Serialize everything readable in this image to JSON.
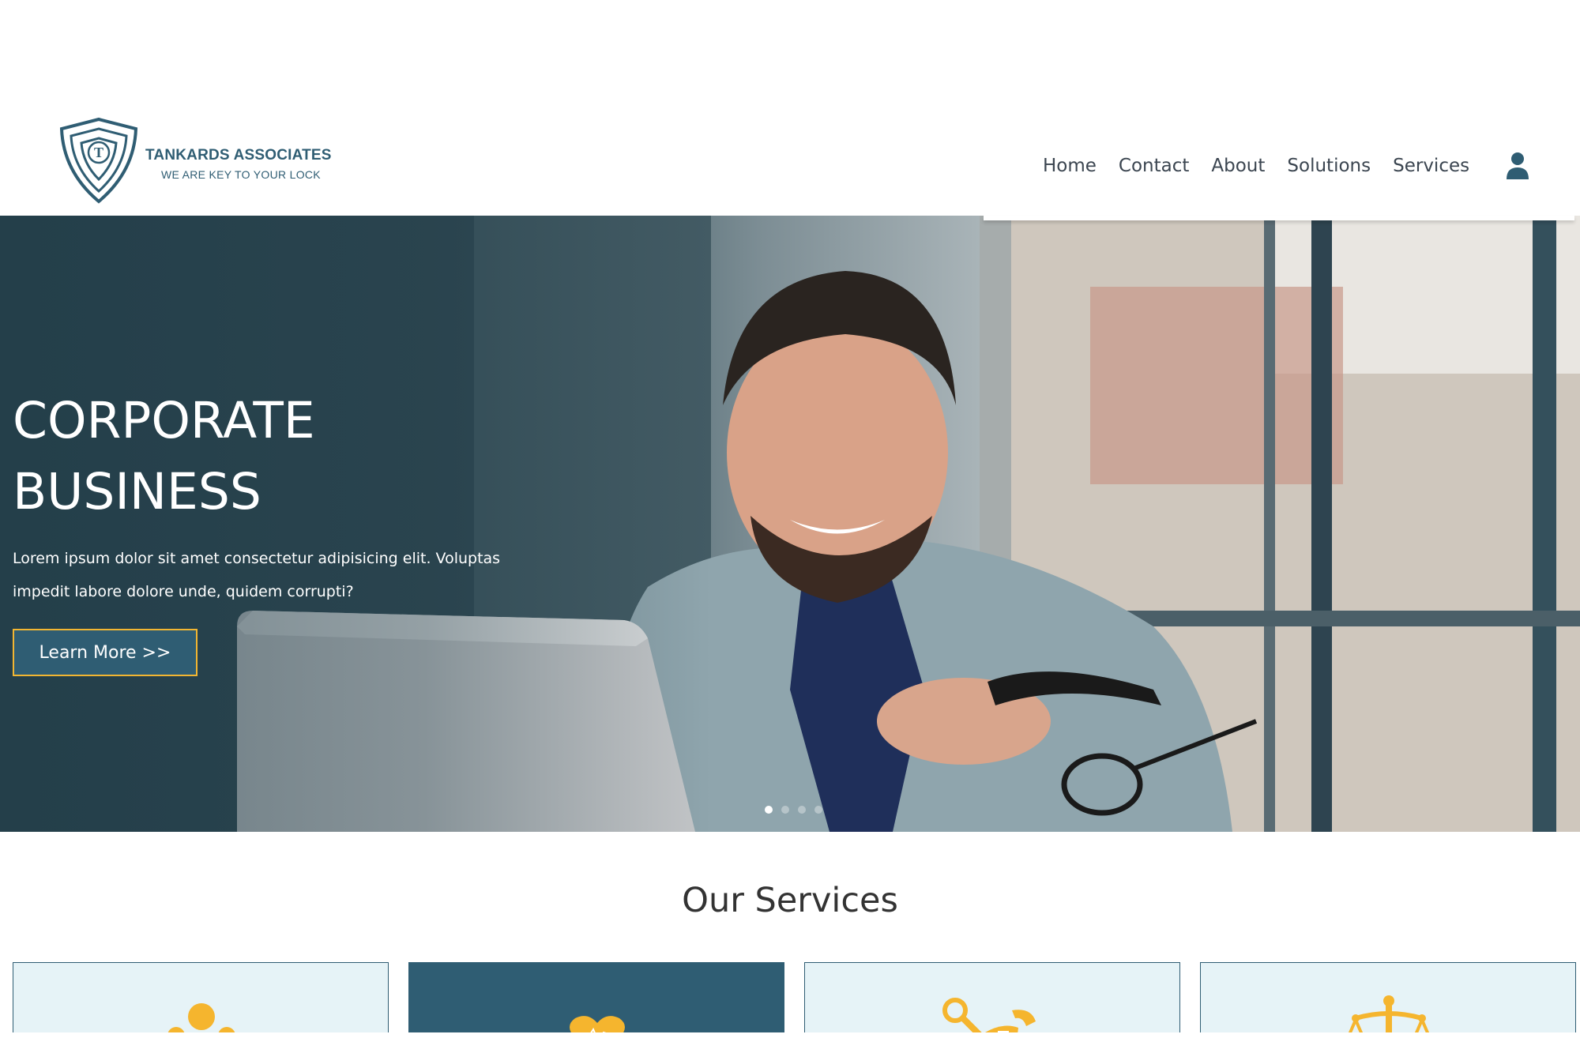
{
  "brand": {
    "name": "TANKARDS ASSOCIATES",
    "tagline": "WE ARE KEY TO YOUR LOCK",
    "logo_letter": "T",
    "color": "#2f5d73"
  },
  "nav": {
    "items": [
      "Home",
      "Contact",
      "About",
      "Solutions",
      "Services"
    ],
    "user_icon": "user-icon"
  },
  "hero": {
    "title_line1": "CORPORATE",
    "title_line2": "BUSINESS",
    "description": "Lorem ipsum dolor sit amet consectetur adipisicing elit. Voluptas impedit labore dolore unde, quidem corrupti?",
    "button_label": "Learn More >>",
    "button_border_color": "#f2b632",
    "slides_count": 4,
    "active_slide": 1
  },
  "services": {
    "title": "Our Services",
    "accent_color": "#f5b52e",
    "cards": [
      {
        "icon": "team-icon",
        "style": "light"
      },
      {
        "icon": "heart-health-icon",
        "style": "dark"
      },
      {
        "icon": "tools-icon",
        "style": "light"
      },
      {
        "icon": "scales-icon",
        "style": "light"
      }
    ]
  }
}
